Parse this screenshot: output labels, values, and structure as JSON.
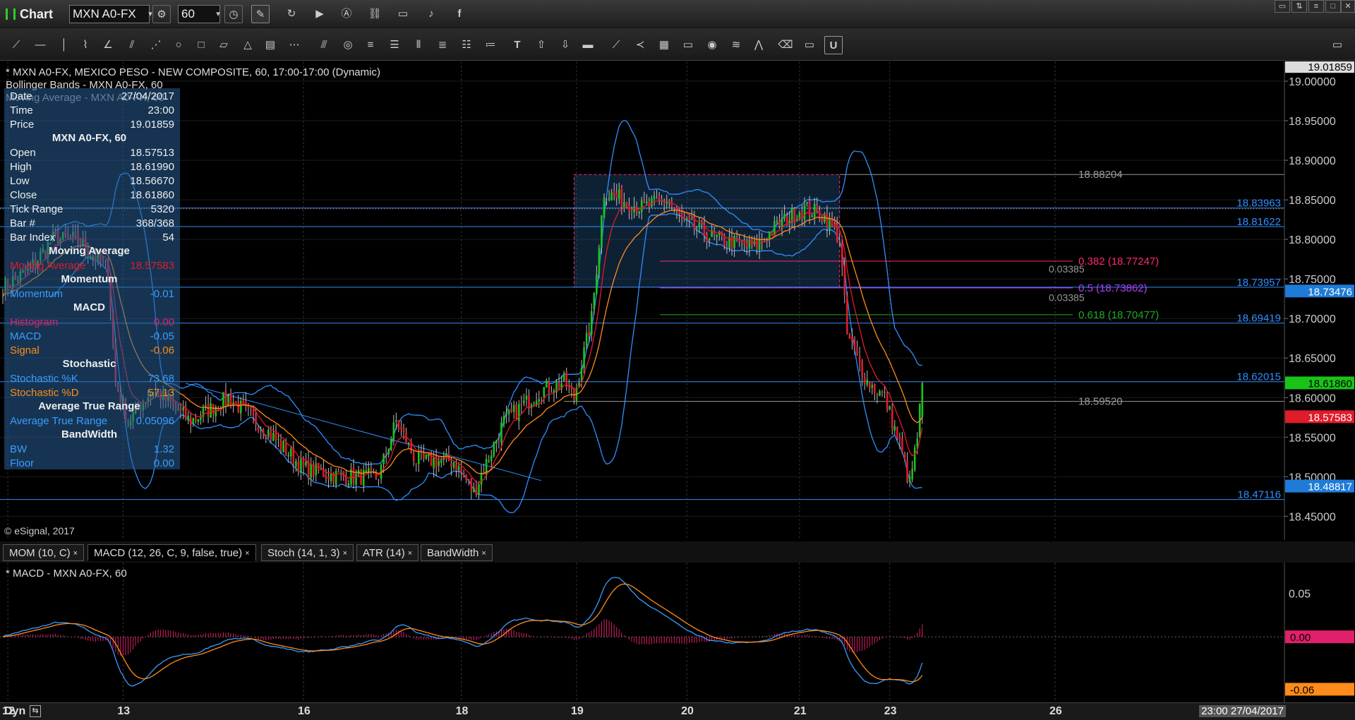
{
  "app": {
    "title": "Chart"
  },
  "toolbar": {
    "symbol": "MXN A0-FX",
    "interval": "60"
  },
  "chart_header": "* MXN A0-FX, MEXICO PESO - NEW COMPOSITE, 60, 17:00-17:00 (Dynamic)",
  "overlays": {
    "bollinger": "Bollinger Bands - MXN A0-FX, 60",
    "moving_avg": "Moving Average - MXN A0-FX, 60"
  },
  "copyright": "© eSignal, 2017",
  "data_window": {
    "rows": [
      {
        "label": "Date",
        "value": "27/04/2017"
      },
      {
        "label": "Time",
        "value": "23:00"
      },
      {
        "label": "Price",
        "value": "19.01859"
      }
    ],
    "title": "MXN A0-FX, 60",
    "ohlc": [
      {
        "label": "Open",
        "value": "18.57513"
      },
      {
        "label": "High",
        "value": "18.61990"
      },
      {
        "label": "Low",
        "value": "18.56670"
      },
      {
        "label": "Close",
        "value": "18.61860"
      },
      {
        "label": "Tick Range",
        "value": "5320"
      },
      {
        "label": "Bar #",
        "value": "368/368"
      },
      {
        "label": "Bar Index",
        "value": "54"
      }
    ],
    "ma_title": "Moving Average",
    "ma_label": "Moving Average",
    "ma_value": "18.57583",
    "mom_title": "Momentum",
    "mom_label": "Momentum",
    "mom_value": "-0.01",
    "macd_title": "MACD",
    "macd_rows": [
      {
        "label": "Histogram",
        "value": "0.00",
        "color": "#e0206a"
      },
      {
        "label": "MACD",
        "value": "-0.05",
        "color": "#3a9cff"
      },
      {
        "label": "Signal",
        "value": "-0.06",
        "color": "#ff8c1a"
      }
    ],
    "stoch_title": "Stochastic",
    "stoch_rows": [
      {
        "label": "Stochastic %K",
        "value": "73.68",
        "color": "#3a9cff"
      },
      {
        "label": "Stochastic %D",
        "value": "57.13",
        "color": "#ff8c1a"
      }
    ],
    "atr_title": "Average True Range",
    "atr_label": "Average True Range",
    "atr_value": "0.05096",
    "bw_title": "BandWidth",
    "bw_rows": [
      {
        "label": "BW",
        "value": "1.32"
      },
      {
        "label": "Floor",
        "value": "0.00"
      }
    ]
  },
  "levels": [
    {
      "price": 18.88204,
      "label": "18.88204",
      "color": "#999999",
      "kind": "gray"
    },
    {
      "price": 18.83963,
      "label": "18.83963",
      "color": "#2f8fff",
      "kind": "blue"
    },
    {
      "price": 18.81622,
      "label": "18.81622",
      "color": "#2f8fff",
      "kind": "blue"
    },
    {
      "price": 18.73957,
      "label": "18.73957",
      "color": "#2f8fff",
      "kind": "blue"
    },
    {
      "price": 18.69419,
      "label": "18.69419",
      "color": "#2f8fff",
      "kind": "blue"
    },
    {
      "price": 18.62015,
      "label": "18.62015",
      "color": "#2f8fff",
      "kind": "blue"
    },
    {
      "price": 18.5952,
      "label": "18.59520",
      "color": "#999999",
      "kind": "gray"
    },
    {
      "price": 18.47116,
      "label": "18.47116",
      "color": "#2f8fff",
      "kind": "blue"
    }
  ],
  "fib": [
    {
      "price": 18.77247,
      "label": "0.382 (18.77247)",
      "color": "#ff2a6a"
    },
    {
      "price": 18.73862,
      "label": "0.5 (18.73862)",
      "color": "#b040ff"
    },
    {
      "price": 18.70477,
      "label": "0.618 (18.70477)",
      "color": "#22aa22"
    }
  ],
  "fib_deltas": [
    "0.03385",
    "0.03385"
  ],
  "price_tags": [
    {
      "price": 19.01859,
      "label": "19.01859",
      "bg": "#dddddd",
      "fg": "#000000"
    },
    {
      "price": 18.73476,
      "label": "18.73476",
      "bg": "#1e7bd8",
      "fg": "#ffffff"
    },
    {
      "price": 18.6186,
      "label": "18.61860",
      "bg": "#19c419",
      "fg": "#000000"
    },
    {
      "price": 18.57583,
      "label": "18.57583",
      "bg": "#e01b2a",
      "fg": "#ffffff"
    },
    {
      "price": 18.48817,
      "label": "18.48817",
      "bg": "#1e7bd8",
      "fg": "#ffffff"
    }
  ],
  "macd_panel": {
    "title": "* MACD - MXN A0-FX, 60",
    "ticks": [
      "0.05"
    ],
    "tags": [
      {
        "value": 0.0,
        "label": "0.00",
        "bg": "#e0206a"
      },
      {
        "value": -0.06,
        "label": "-0.06",
        "bg": "#ff8c1a"
      }
    ]
  },
  "tabs": [
    {
      "label": "MOM (10, C)"
    },
    {
      "label": "MACD (12, 26, C, 9, false, true)"
    },
    {
      "label": "Stoch (14, 1, 3)"
    },
    {
      "label": "ATR (14)"
    },
    {
      "label": "BandWidth"
    }
  ],
  "x_axis": {
    "labels": [
      {
        "day": "12",
        "bar": 2
      },
      {
        "day": "13",
        "bar": 48
      },
      {
        "day": "16",
        "bar": 120
      },
      {
        "day": "18",
        "bar": 183
      },
      {
        "day": "19",
        "bar": 229
      },
      {
        "day": "20",
        "bar": 273
      },
      {
        "day": "21",
        "bar": 318
      },
      {
        "day": "23",
        "bar": 354
      },
      {
        "day": "26",
        "bar": 420
      }
    ],
    "corner": "Dyn",
    "date_box": "23:00 27/04/2017"
  },
  "y_axis": {
    "ticks": [
      "19.00000",
      "18.95000",
      "18.90000",
      "18.85000",
      "18.80000",
      "18.75000",
      "18.70000",
      "18.65000",
      "18.60000",
      "18.55000",
      "18.50000",
      "18.45000"
    ]
  },
  "chart_data": {
    "type": "candlestick",
    "symbol": "MXN A0-FX",
    "interval": "60",
    "ylim": [
      18.42,
      19.025
    ],
    "anchors": [
      {
        "bar": 0,
        "close": 18.74
      },
      {
        "bar": 10,
        "close": 18.76
      },
      {
        "bar": 20,
        "close": 18.8
      },
      {
        "bar": 30,
        "close": 18.8
      },
      {
        "bar": 42,
        "close": 18.76
      },
      {
        "bar": 45,
        "close": 18.62
      },
      {
        "bar": 50,
        "close": 18.57
      },
      {
        "bar": 60,
        "close": 18.61
      },
      {
        "bar": 75,
        "close": 18.57
      },
      {
        "bar": 90,
        "close": 18.6
      },
      {
        "bar": 105,
        "close": 18.56
      },
      {
        "bar": 120,
        "close": 18.51
      },
      {
        "bar": 135,
        "close": 18.5
      },
      {
        "bar": 150,
        "close": 18.5
      },
      {
        "bar": 157,
        "close": 18.57
      },
      {
        "bar": 165,
        "close": 18.52
      },
      {
        "bar": 180,
        "close": 18.52
      },
      {
        "bar": 188,
        "close": 18.48
      },
      {
        "bar": 200,
        "close": 18.57
      },
      {
        "bar": 215,
        "close": 18.61
      },
      {
        "bar": 224,
        "close": 18.62
      },
      {
        "bar": 228,
        "close": 18.6
      },
      {
        "bar": 235,
        "close": 18.7
      },
      {
        "bar": 240,
        "close": 18.86
      },
      {
        "bar": 255,
        "close": 18.84
      },
      {
        "bar": 265,
        "close": 18.85
      },
      {
        "bar": 272,
        "close": 18.82
      },
      {
        "bar": 285,
        "close": 18.8
      },
      {
        "bar": 300,
        "close": 18.79
      },
      {
        "bar": 310,
        "close": 18.82
      },
      {
        "bar": 320,
        "close": 18.84
      },
      {
        "bar": 328,
        "close": 18.83
      },
      {
        "bar": 334,
        "close": 18.8
      },
      {
        "bar": 337,
        "close": 18.68
      },
      {
        "bar": 345,
        "close": 18.62
      },
      {
        "bar": 352,
        "close": 18.6
      },
      {
        "bar": 358,
        "close": 18.54
      },
      {
        "bar": 362,
        "close": 18.49
      },
      {
        "bar": 365,
        "close": 18.55
      },
      {
        "bar": 367,
        "close": 18.6186
      }
    ],
    "last": {
      "open": 18.57513,
      "high": 18.6199,
      "low": 18.5667,
      "close": 18.6186
    },
    "moving_average": 18.57583,
    "macd": {
      "histogram": 0.0,
      "macd": -0.05,
      "signal": -0.06,
      "ylim": [
        -0.075,
        0.085
      ]
    },
    "colors": {
      "up": "#19c419",
      "down": "#e01b2a",
      "bands": "#2f8fff",
      "ma_fast": "#e01b2a",
      "ma_slow": "#ff8c1a"
    }
  }
}
